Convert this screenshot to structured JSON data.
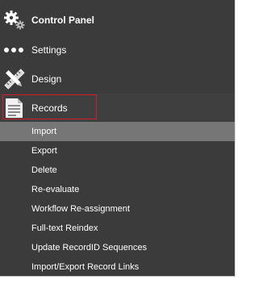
{
  "nav": {
    "control_panel": {
      "label": "Control Panel",
      "icon": "gears-icon"
    },
    "settings": {
      "label": "Settings",
      "icon": "dots-icon"
    },
    "design": {
      "label": "Design",
      "icon": "ruler-pencil-icon"
    },
    "records": {
      "label": "Records",
      "icon": "document-icon"
    }
  },
  "records_menu": [
    {
      "label": "Import",
      "active": true
    },
    {
      "label": "Export"
    },
    {
      "label": "Delete"
    },
    {
      "label": "Re-evaluate"
    },
    {
      "label": "Workflow Re-assignment"
    },
    {
      "label": "Full-text Reindex"
    },
    {
      "label": "Update RecordID Sequences"
    },
    {
      "label": "Import/Export Record Links"
    }
  ],
  "colors": {
    "panel_bg": "#3b3b3b",
    "active_item_bg": "#767676",
    "highlight_border": "#d01e2a",
    "text": "#ffffff"
  }
}
